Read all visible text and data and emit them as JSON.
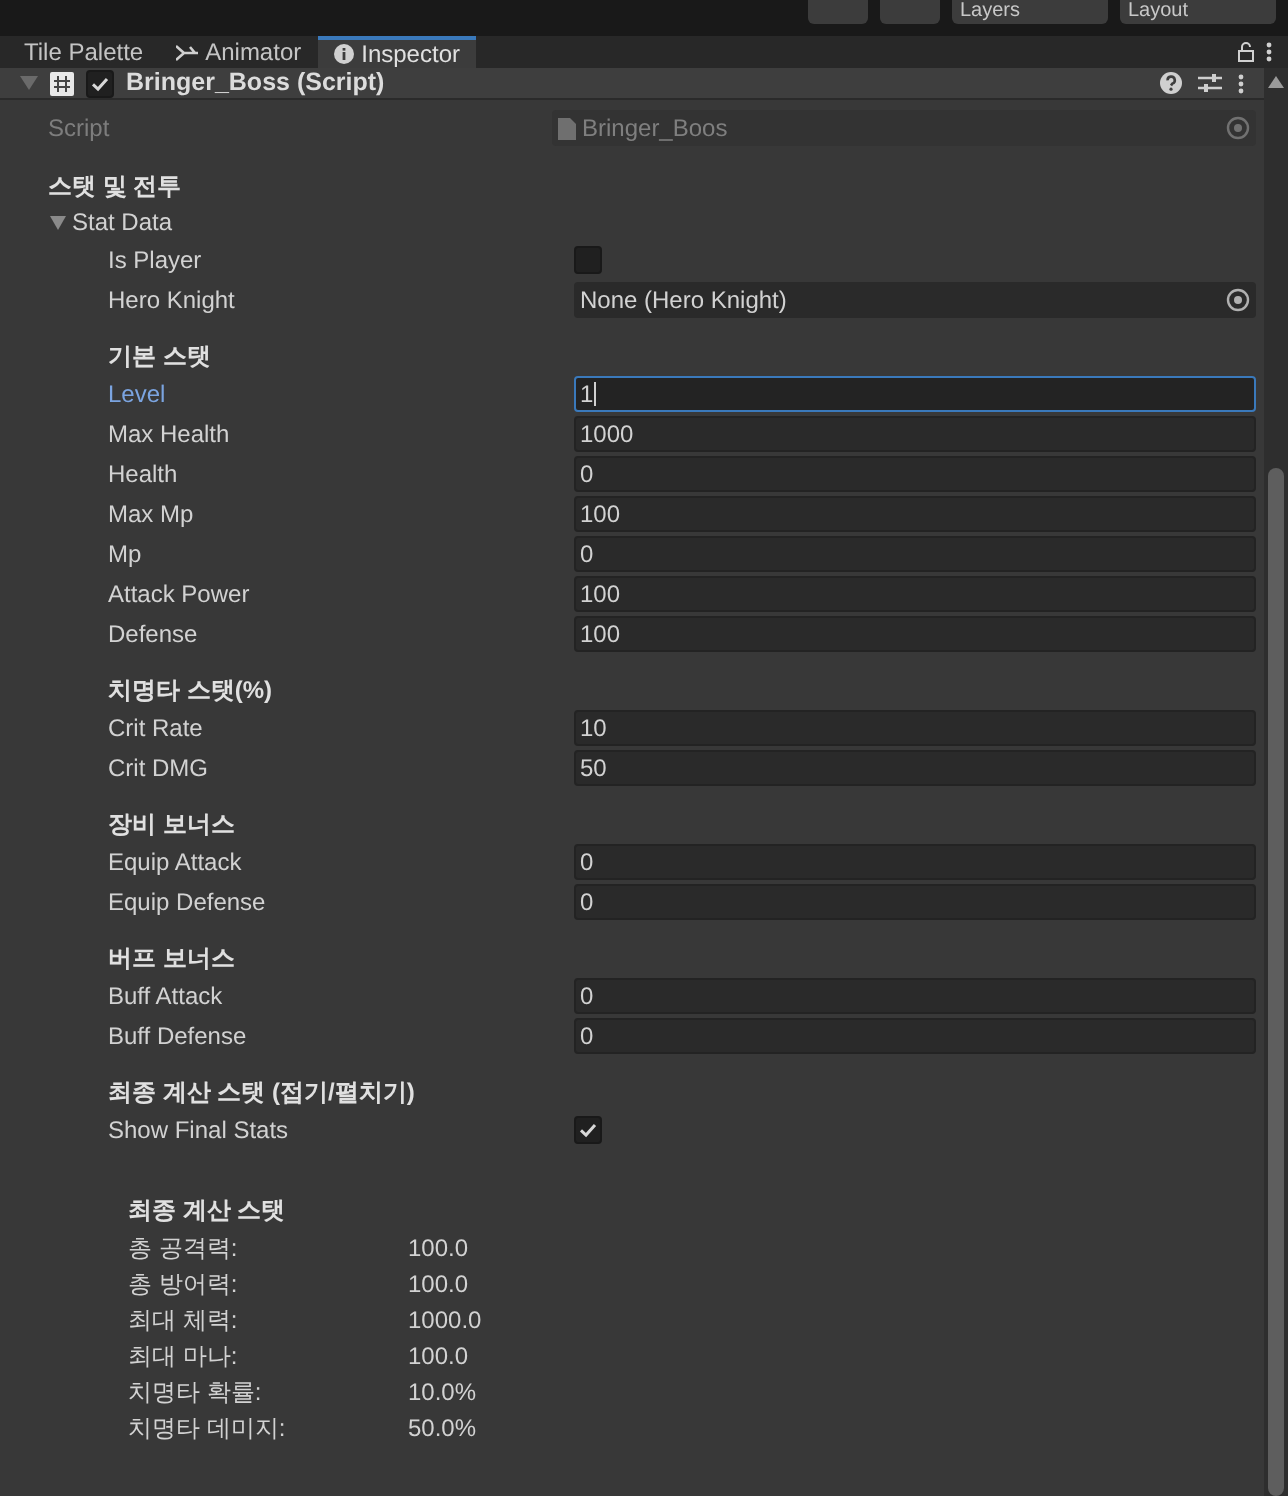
{
  "toolbar": {
    "dropdowns": [
      "Layers",
      "Layout"
    ]
  },
  "tabs": [
    {
      "label": "Tile Palette",
      "selected": false
    },
    {
      "label": "Animator",
      "selected": false
    },
    {
      "label": "Inspector",
      "selected": true
    }
  ],
  "component": {
    "title": "Bringer_Boss (Script)",
    "enabled": true,
    "expanded": true
  },
  "script_field": {
    "label": "Script",
    "value": "Bringer_Boos"
  },
  "section_title": "스탯 및 전투",
  "foldout": {
    "label": "Stat Data",
    "expanded": true
  },
  "fields": [
    {
      "kind": "checkbox",
      "label": "Is Player",
      "checked": false
    },
    {
      "kind": "object",
      "label": "Hero Knight",
      "value": "None (Hero Knight)"
    },
    {
      "kind": "header",
      "label": "기본 스탯"
    },
    {
      "kind": "number",
      "label": "Level",
      "value": "1",
      "focused": true
    },
    {
      "kind": "number",
      "label": "Max Health",
      "value": "1000",
      "focused": false
    },
    {
      "kind": "number",
      "label": "Health",
      "value": "0",
      "focused": false
    },
    {
      "kind": "number",
      "label": "Max Mp",
      "value": "100",
      "focused": false
    },
    {
      "kind": "number",
      "label": "Mp",
      "value": "0",
      "focused": false
    },
    {
      "kind": "number",
      "label": "Attack Power",
      "value": "100",
      "focused": false
    },
    {
      "kind": "number",
      "label": "Defense",
      "value": "100",
      "focused": false
    },
    {
      "kind": "header",
      "label": "치명타 스탯(%)"
    },
    {
      "kind": "number",
      "label": "Crit Rate",
      "value": "10",
      "focused": false
    },
    {
      "kind": "number",
      "label": "Crit DMG",
      "value": "50",
      "focused": false
    },
    {
      "kind": "header",
      "label": "장비 보너스"
    },
    {
      "kind": "number",
      "label": "Equip Attack",
      "value": "0",
      "focused": false
    },
    {
      "kind": "number",
      "label": "Equip Defense",
      "value": "0",
      "focused": false
    },
    {
      "kind": "header",
      "label": "버프 보너스"
    },
    {
      "kind": "number",
      "label": "Buff Attack",
      "value": "0",
      "focused": false
    },
    {
      "kind": "number",
      "label": "Buff Defense",
      "value": "0",
      "focused": false
    },
    {
      "kind": "header",
      "label": "최종 계산 스탯 (접기/펼치기)"
    },
    {
      "kind": "checkbox",
      "label": "Show Final Stats",
      "checked": true
    }
  ],
  "final_stats": {
    "title": "최종 계산 스탯",
    "rows": [
      {
        "label": "총 공격력:",
        "value": "100.0"
      },
      {
        "label": "총 방어력:",
        "value": "100.0"
      },
      {
        "label": "최대 체력:",
        "value": "1000.0"
      },
      {
        "label": "최대 마나:",
        "value": "100.0"
      },
      {
        "label": "치명타 확률:",
        "value": "10.0%"
      },
      {
        "label": "치명타 데미지:",
        "value": "50.0%"
      }
    ]
  }
}
